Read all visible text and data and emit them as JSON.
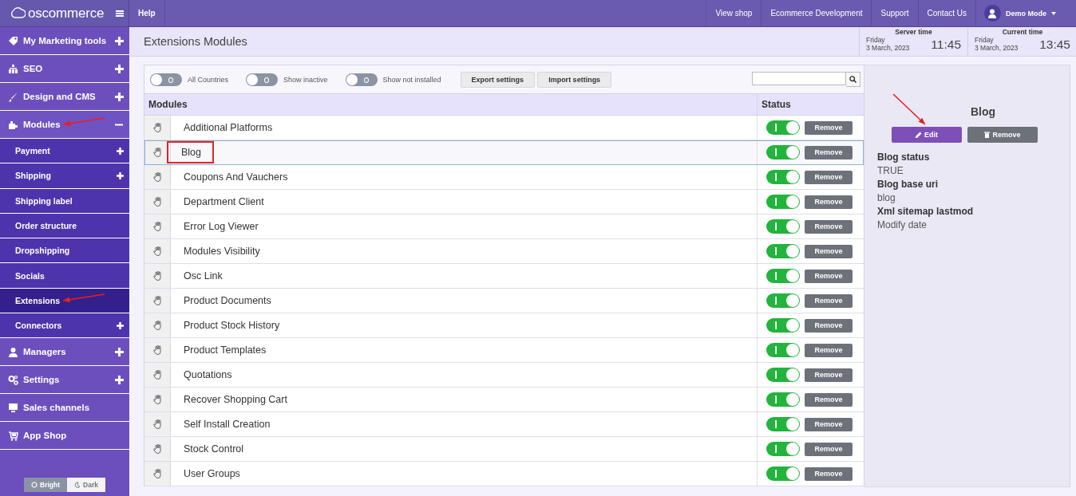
{
  "header": {
    "logo": "oscommerce",
    "links": [
      "Help"
    ],
    "right_links": [
      "View shop",
      "Ecommerce Development",
      "Support",
      "Contact Us"
    ],
    "user": "Demo Mode"
  },
  "sidebar": {
    "items": [
      {
        "label": "My Marketing tools",
        "kind": "group",
        "expanded": false,
        "selected": false
      },
      {
        "label": "SEO",
        "kind": "group",
        "expanded": false,
        "selected": false
      },
      {
        "label": "Design and CMS",
        "kind": "group",
        "expanded": false,
        "selected": false
      },
      {
        "label": "Modules",
        "kind": "group",
        "expanded": true,
        "selected": false,
        "arrow": true,
        "children": [
          {
            "label": "Payment",
            "kind": "group",
            "expanded": false,
            "selected": false
          },
          {
            "label": "Shipping",
            "kind": "group",
            "expanded": false,
            "selected": false
          },
          {
            "label": "Shipping label",
            "kind": "link",
            "selected": false
          },
          {
            "label": "Order structure",
            "kind": "link",
            "selected": false
          },
          {
            "label": "Dropshipping",
            "kind": "link",
            "selected": false
          },
          {
            "label": "Socials",
            "kind": "link",
            "selected": false
          },
          {
            "label": "Extensions",
            "kind": "link",
            "selected": true,
            "arrow": true
          },
          {
            "label": "Connectors",
            "kind": "group",
            "expanded": false,
            "selected": false
          }
        ]
      },
      {
        "label": "Managers",
        "kind": "group",
        "expanded": false,
        "selected": false
      },
      {
        "label": "Settings",
        "kind": "group",
        "expanded": false,
        "selected": false
      },
      {
        "label": "Sales channels",
        "kind": "link",
        "selected": false
      },
      {
        "label": "App Shop",
        "kind": "link",
        "selected": false
      }
    ],
    "theme": [
      {
        "label": "Bright",
        "selected": true
      },
      {
        "label": "Dark",
        "selected": false
      }
    ]
  },
  "page": {
    "title": "Extensions Modules",
    "clocks": [
      {
        "label": "Server time",
        "day": "Friday",
        "date": "3 March, 2023",
        "time": "11:45"
      },
      {
        "label": "Current time",
        "day": "Friday",
        "date": "3 March, 2023",
        "time": "13:45"
      }
    ]
  },
  "toolbar": {
    "toggles": [
      {
        "label": "All Countries",
        "on": false
      },
      {
        "label": "Show inactive",
        "on": false
      },
      {
        "label": "Show not installed",
        "on": false
      }
    ],
    "buttons": [
      "Export settings",
      "Import settings"
    ]
  },
  "table": {
    "columns": [
      "Modules",
      "Status"
    ],
    "rows": [
      {
        "name": "Additional Platforms",
        "on": true,
        "selected": false,
        "action": "Remove"
      },
      {
        "name": "Blog",
        "on": true,
        "selected": true,
        "outlined": true,
        "action": "Remove"
      },
      {
        "name": "Coupons And Vauchers",
        "on": true,
        "selected": false,
        "action": "Remove"
      },
      {
        "name": "Department Client",
        "on": true,
        "selected": false,
        "action": "Remove"
      },
      {
        "name": "Error Log Viewer",
        "on": true,
        "selected": false,
        "action": "Remove"
      },
      {
        "name": "Modules Visibility",
        "on": true,
        "selected": false,
        "action": "Remove"
      },
      {
        "name": "Osc Link",
        "on": true,
        "selected": false,
        "action": "Remove"
      },
      {
        "name": "Product Documents",
        "on": true,
        "selected": false,
        "action": "Remove"
      },
      {
        "name": "Product Stock History",
        "on": true,
        "selected": false,
        "action": "Remove"
      },
      {
        "name": "Product Templates",
        "on": true,
        "selected": false,
        "action": "Remove"
      },
      {
        "name": "Quotations",
        "on": true,
        "selected": false,
        "action": "Remove"
      },
      {
        "name": "Recover Shopping Cart",
        "on": true,
        "selected": false,
        "action": "Remove"
      },
      {
        "name": "Self Install Creation",
        "on": true,
        "selected": false,
        "action": "Remove"
      },
      {
        "name": "Stock Control",
        "on": true,
        "selected": false,
        "action": "Remove"
      },
      {
        "name": "User Groups",
        "on": true,
        "selected": false,
        "action": "Remove"
      }
    ]
  },
  "detail": {
    "title": "Blog",
    "buttons": [
      {
        "label": "Edit",
        "kind": "edit",
        "arrow": true
      },
      {
        "label": "Remove",
        "kind": "remove"
      }
    ],
    "fields": [
      {
        "label": "Blog status",
        "value": "TRUE"
      },
      {
        "label": "Blog base uri",
        "value": "blog"
      },
      {
        "label": "Xml sitemap lastmod",
        "value": "Modify date"
      }
    ]
  }
}
